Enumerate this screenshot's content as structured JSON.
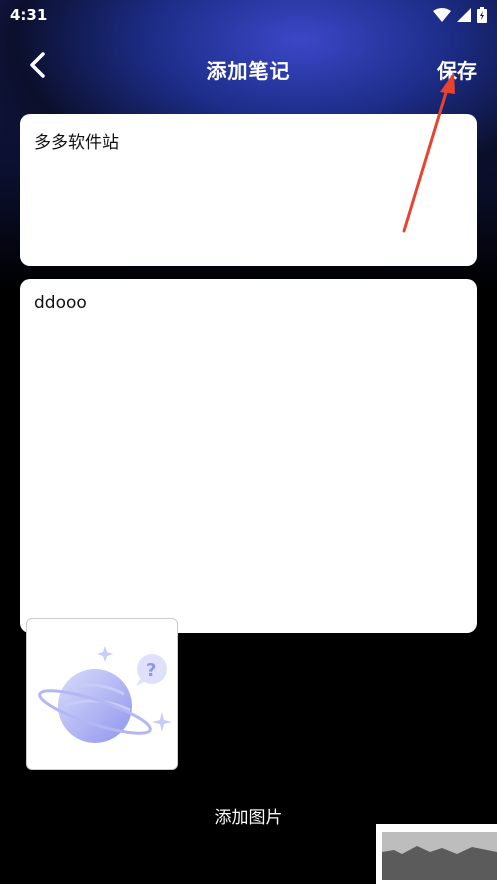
{
  "status_bar": {
    "time": "4:31"
  },
  "header": {
    "title": "添加笔记",
    "save_label": "保存"
  },
  "note": {
    "title": "多多软件站",
    "body": "ddooo"
  },
  "image_picker": {
    "add_label": "添加图片"
  },
  "colors": {
    "arrow": "#e8432e",
    "accent": "#2f3fb8"
  }
}
